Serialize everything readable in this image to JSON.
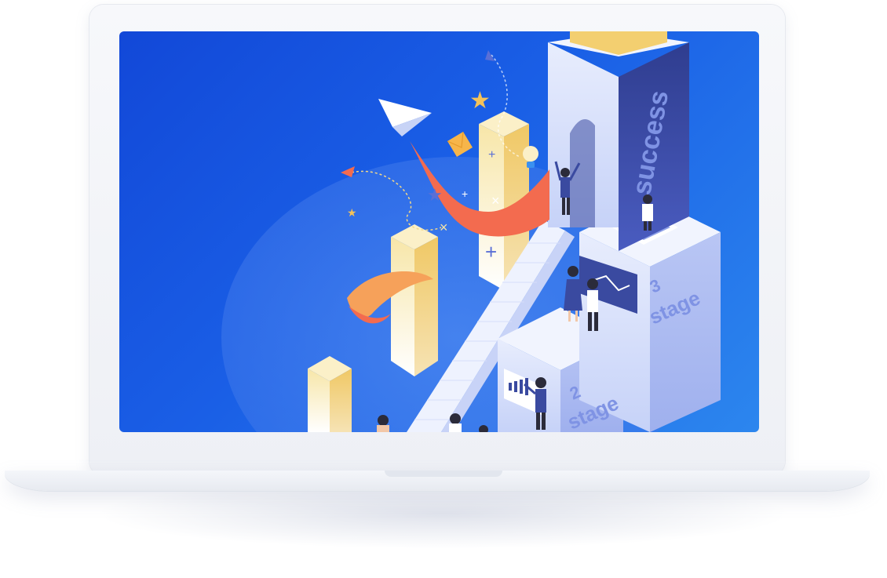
{
  "illustration": {
    "tower_label": "success",
    "stage3_number": "3",
    "stage3_word": "stage",
    "stage2_number": "2",
    "stage2_word": "stage"
  },
  "colors": {
    "screen_blue": "#1a5fe6",
    "block_light": "#dfe6fb",
    "block_shade": "#aebbf1",
    "tower_dark": "#3a4aa0",
    "bar_yellow": "#f3d98a",
    "ribbon": "#f36b4f"
  }
}
